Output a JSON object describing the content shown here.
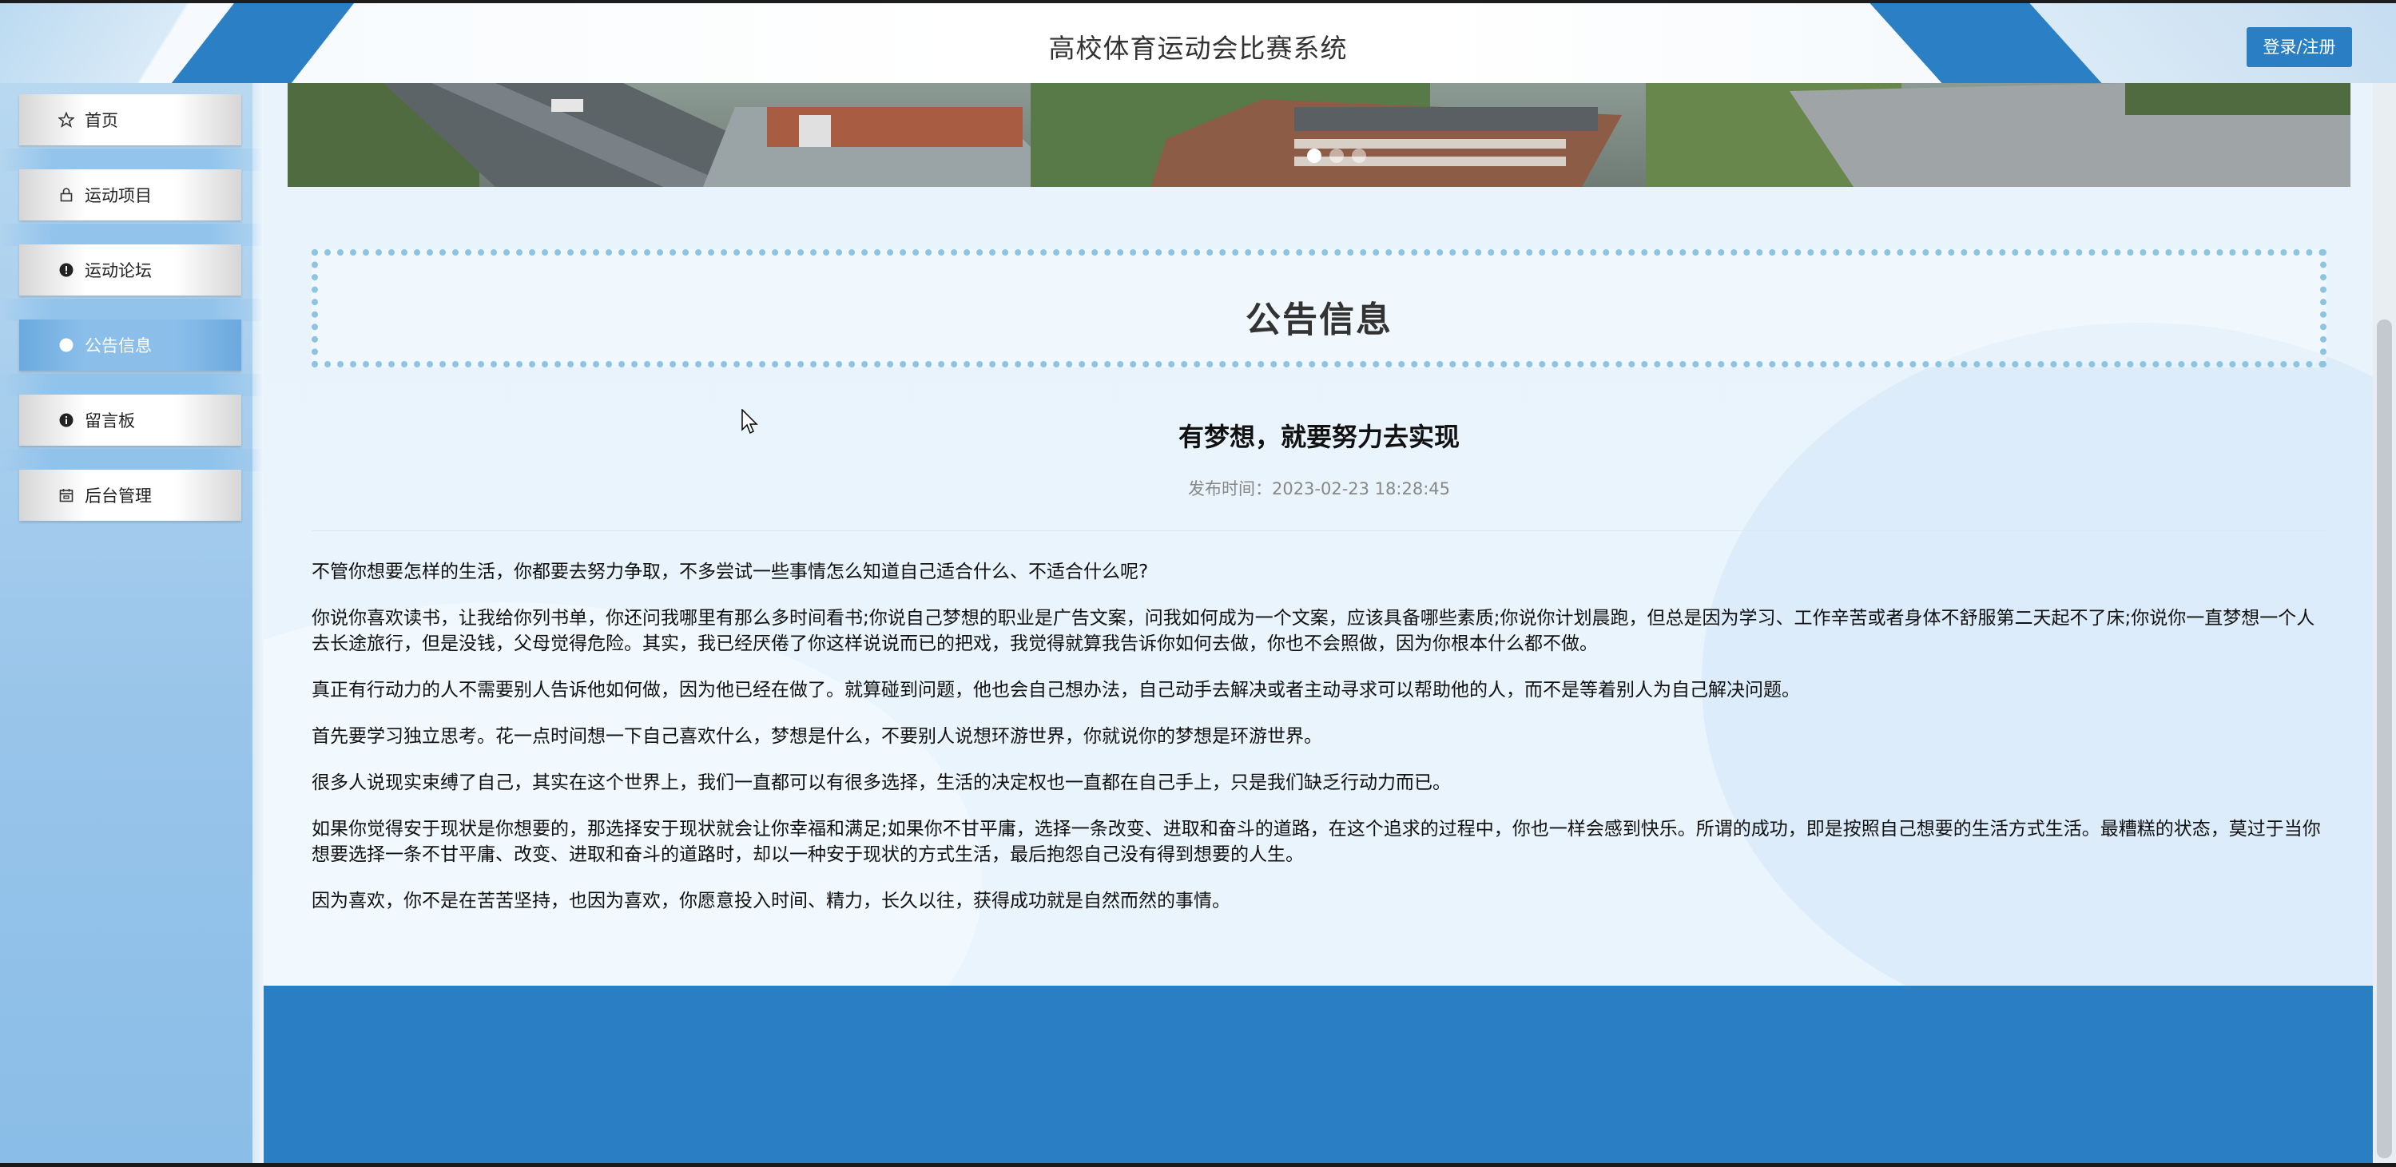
{
  "header": {
    "title": "高校体育运动会比赛系统",
    "login_label": "登录/注册"
  },
  "sidebar": {
    "items": [
      {
        "label": "首页",
        "icon": "star-icon",
        "active": false
      },
      {
        "label": "运动项目",
        "icon": "lock-icon",
        "active": false
      },
      {
        "label": "运动论坛",
        "icon": "exclamation-circle-icon",
        "active": false
      },
      {
        "label": "公告信息",
        "icon": "circle-icon",
        "active": true
      },
      {
        "label": "留言板",
        "icon": "info-circle-icon",
        "active": false
      },
      {
        "label": "后台管理",
        "icon": "calendar-icon",
        "active": false
      }
    ]
  },
  "banner": {
    "slides": 3,
    "active_slide": 1
  },
  "main": {
    "section_title": "公告信息",
    "article": {
      "title": "有梦想，就要努力去实现",
      "meta": "发布时间：2023-02-23 18:28:45",
      "paragraphs": [
        "不管你想要怎样的生活，你都要去努力争取，不多尝试一些事情怎么知道自己适合什么、不适合什么呢?",
        "你说你喜欢读书，让我给你列书单，你还问我哪里有那么多时间看书;你说自己梦想的职业是广告文案，问我如何成为一个文案，应该具备哪些素质;你说你计划晨跑，但总是因为学习、工作辛苦或者身体不舒服第二天起不了床;你说你一直梦想一个人去长途旅行，但是没钱，父母觉得危险。其实，我已经厌倦了你这样说说而已的把戏，我觉得就算我告诉你如何去做，你也不会照做，因为你根本什么都不做。",
        "真正有行动力的人不需要别人告诉他如何做，因为他已经在做了。就算碰到问题，他也会自己想办法，自己动手去解决或者主动寻求可以帮助他的人，而不是等着别人为自己解决问题。",
        "首先要学习独立思考。花一点时间想一下自己喜欢什么，梦想是什么，不要别人说想环游世界，你就说你的梦想是环游世界。",
        "很多人说现实束缚了自己，其实在这个世界上，我们一直都可以有很多选择，生活的决定权也一直都在自己手上，只是我们缺乏行动力而已。",
        "如果你觉得安于现状是你想要的，那选择安于现状就会让你幸福和满足;如果你不甘平庸，选择一条改变、进取和奋斗的道路，在这个追求的过程中，你也一样会感到快乐。所谓的成功，即是按照自己想要的生活方式生活。最糟糕的状态，莫过于当你想要选择一条不甘平庸、改变、进取和奋斗的道路时，却以一种安于现状的方式生活，最后抱怨自己没有得到想要的人生。",
        "因为喜欢，你不是在苦苦坚持，也因为喜欢，你愿意投入时间、精力，长久以往，获得成功就是自然而然的事情。"
      ]
    }
  },
  "colors": {
    "primary": "#2a7ec4",
    "sidebar_active": "#8bbfea",
    "dotted_border": "#8fc4df"
  }
}
